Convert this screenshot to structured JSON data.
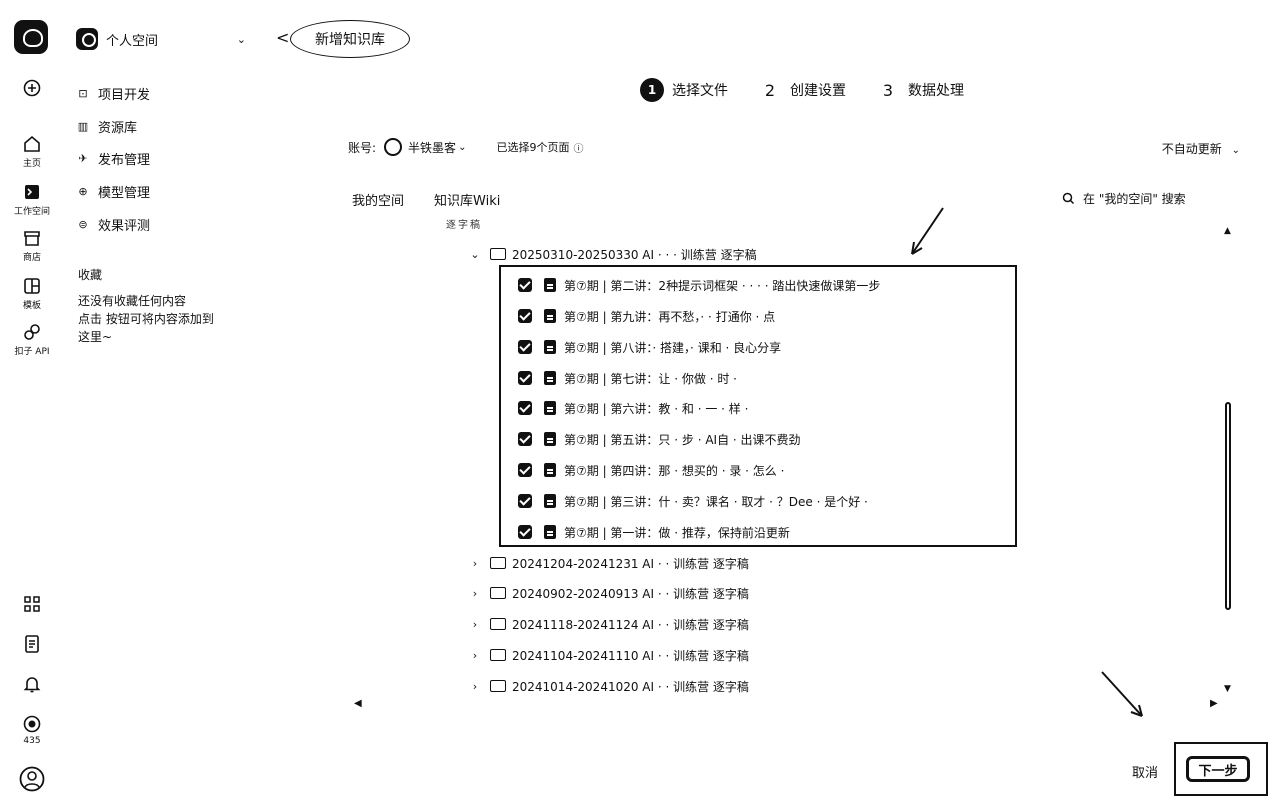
{
  "rail": {
    "items": [
      {
        "name": "create",
        "label": ""
      },
      {
        "name": "home",
        "label": "主页"
      },
      {
        "name": "workspace",
        "label": "工作空间"
      },
      {
        "name": "store",
        "label": "商店"
      },
      {
        "name": "templates",
        "label": "模板"
      },
      {
        "name": "coze-api",
        "label": "扣子 API"
      }
    ],
    "bottom": {
      "badge_count": "435"
    }
  },
  "sidebar": {
    "space_name": "个人空间",
    "nav": [
      "项目开发",
      "资源库",
      "发布管理",
      "模型管理",
      "效果评测"
    ],
    "favorites_title": "收藏",
    "favorites_empty": [
      "还没有收藏任何内容",
      "点击    按钮可将内容添加到",
      "这里~"
    ]
  },
  "header": {
    "title": "新增知识库",
    "back": "<"
  },
  "stepper": [
    {
      "num": "1",
      "label": "选择文件",
      "active": true
    },
    {
      "num": "2",
      "label": "创建设置",
      "active": false
    },
    {
      "num": "3",
      "label": "数据处理",
      "active": false
    }
  ],
  "account": {
    "label": "账号:",
    "name": "半铁墨客",
    "selected": "已选择9个页面",
    "auto_update": "不自动更新"
  },
  "tabs": [
    "我的空间",
    "知识库Wiki"
  ],
  "search": {
    "placeholder": "在 \"我的空间\" 搜索"
  },
  "tree": {
    "clipped_label": "逐字稿",
    "expanded_folder": "20250310-20250330 AI · · · 训练营 逐字稿",
    "files": [
      "第⑦期 | 第二讲：2种提示词框架 · · · · 踏出快速做课第一步",
      "第⑦期 | 第九讲：再不愁，· · 打通你 · 点",
      "第⑦期 | 第八讲：· 搭建，· 课和 · 良心分享",
      "第⑦期 | 第七讲：让 · 你做 · 时 · ",
      "第⑦期 | 第六讲：教 · 和 · 一 · 样 · ",
      "第⑦期 | 第五讲：只 · 步 · AI自 · 出课不费劲",
      "第⑦期 | 第四讲：那 · 想买的 · 录 · 怎么 · ",
      "第⑦期 | 第三讲：什 · 卖？课名 · 取才 · ？Dee · 是个好 · ",
      "第⑦期 | 第一讲：做 · 推荐，保持前沿更新"
    ],
    "collapsed_folders": [
      "20241204-20241231 AI · · 训练营 逐字稿",
      "20240902-20240913 AI · · 训练营 逐字稿",
      "20241118-20241124 AI · · 训练营 逐字稿",
      "20241104-20241110 AI · · 训练营 逐字稿",
      "20241014-20241020 AI · · 训练营 逐字稿"
    ]
  },
  "footer": {
    "cancel": "取消",
    "next": "下一步"
  }
}
